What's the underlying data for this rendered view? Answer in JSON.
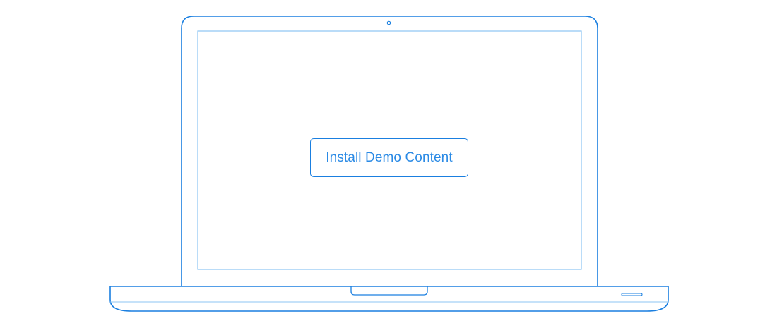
{
  "install_button": {
    "label": "Install Demo Content"
  },
  "colors": {
    "outline": "#1a7fe0",
    "screen_border": "#8cc4f3",
    "button_text": "#2a8ae5",
    "background": "#ffffff"
  },
  "icons": {
    "laptop": "laptop-outline-icon",
    "camera": "webcam-icon"
  }
}
